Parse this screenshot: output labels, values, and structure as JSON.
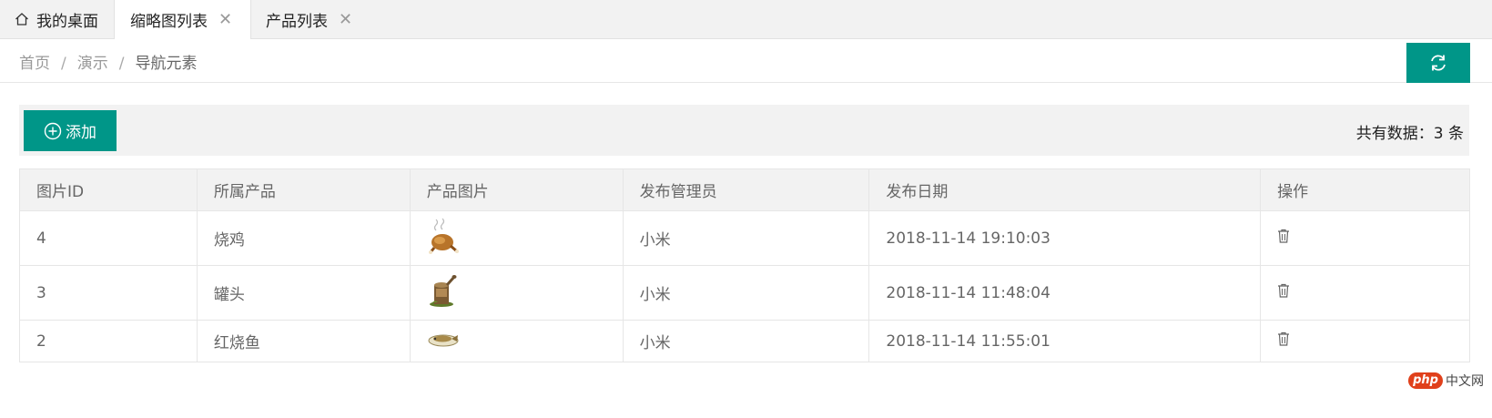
{
  "tabs": [
    {
      "label": "我的桌面",
      "icon": "home-icon",
      "active": false,
      "closable": false
    },
    {
      "label": "缩略图列表",
      "active": true,
      "closable": true
    },
    {
      "label": "产品列表",
      "active": false,
      "closable": true
    }
  ],
  "breadcrumb": [
    "首页",
    "演示",
    "导航元素"
  ],
  "toolbar": {
    "add_label": "添加",
    "total_text": "共有数据：3 条"
  },
  "table": {
    "headers": [
      "图片ID",
      "所属产品",
      "产品图片",
      "发布管理员",
      "发布日期",
      "操作"
    ],
    "rows": [
      {
        "id": "4",
        "product": "烧鸡",
        "image": "roast-chicken-image",
        "admin": "小米",
        "date": "2018-11-14 19:10:03",
        "action": "trash-icon"
      },
      {
        "id": "3",
        "product": "罐头",
        "image": "canned-food-image",
        "admin": "小米",
        "date": "2018-11-14 11:48:04",
        "action": "trash-icon"
      },
      {
        "id": "2",
        "product": "红烧鱼",
        "image": "braised-fish-image",
        "admin": "小米",
        "date": "2018-11-14 11:55:01",
        "action": "trash-icon"
      }
    ]
  },
  "watermark": {
    "badge": "php",
    "text": "中文网"
  },
  "colors": {
    "accent": "#009688",
    "tabbar_bg": "#f2f2f2",
    "border": "#e6e6e6",
    "watermark_badge": "#e0401b"
  }
}
